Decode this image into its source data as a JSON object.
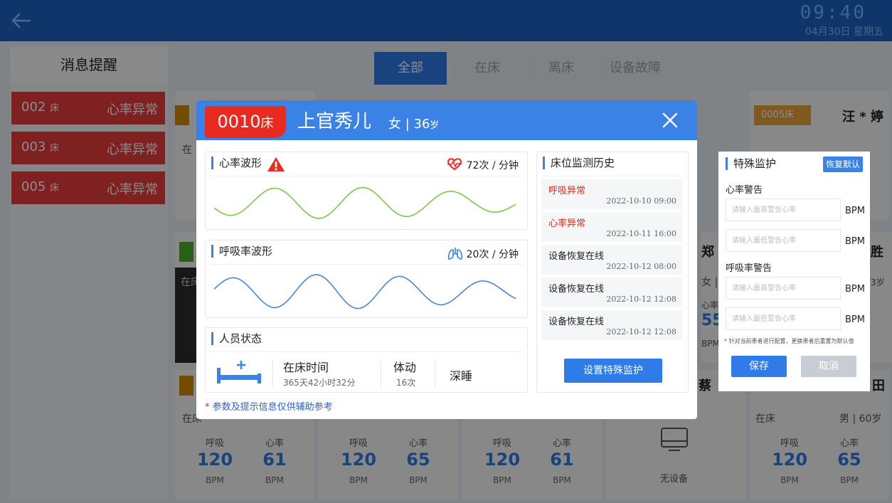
{
  "header": {
    "time": "09:40",
    "date": "04月30日  星期五"
  },
  "sidebar": {
    "title": "消息提醒",
    "alerts": [
      {
        "bed": "002",
        "unit": "床",
        "message": "心率异常"
      },
      {
        "bed": "003",
        "unit": "床",
        "message": "心率异常"
      },
      {
        "bed": "005",
        "unit": "床",
        "message": "心率异常"
      }
    ]
  },
  "filters": [
    "全部",
    "在床",
    "离床",
    "设备故障"
  ],
  "background_cards": {
    "card_5": {
      "bed": "0005床",
      "name": "汪 * 婷"
    },
    "partial_names": [
      "郑",
      "胜",
      "蔡",
      "田"
    ],
    "card_right": {
      "status": "在床",
      "gender_age": "男 | 60岁"
    },
    "metrics": [
      {
        "resp_label": "呼吸",
        "resp": "120",
        "hr_label": "心率",
        "hr": "61",
        "unit": "BPM"
      },
      {
        "resp_label": "呼吸",
        "resp": "120",
        "hr_label": "心率",
        "hr": "65",
        "unit": "BPM"
      },
      {
        "resp_label": "呼吸",
        "resp": "120",
        "hr_label": "心率",
        "hr": "61",
        "unit": "BPM"
      },
      {
        "resp_label": "呼吸",
        "resp": "120",
        "hr_label": "心率",
        "hr": "65",
        "unit": "BPM"
      }
    ],
    "no_device": "无设备",
    "fragments": {
      "in_bed": "在床",
      "heart": "心率",
      "val": "55",
      "bpm": "BPM",
      "female": "女 |",
      "age": "3岁",
      "left_in": "在床",
      "left_in2": "在"
    }
  },
  "modal": {
    "bed_number": "0010",
    "bed_unit": "床",
    "patient_name": "上官秀儿",
    "gender": "女",
    "age": "36",
    "age_unit": "岁",
    "heart_panel": {
      "title": "心率波形",
      "rate": "72次 / 分钟"
    },
    "resp_panel": {
      "title": "呼吸率波形",
      "rate": "20次 / 分钟"
    },
    "status_panel": {
      "title": "人员状态",
      "bed_time_label": "在床时间",
      "bed_time_value": "365天42小时32分",
      "movement_label": "体动",
      "movement_value": "16次",
      "sleep_state": "深睡"
    },
    "history_panel": {
      "title": "床位监测历史",
      "items": [
        {
          "label": "呼吸异常",
          "time": "2022-10-10  09:00",
          "alert": true
        },
        {
          "label": "心率异常",
          "time": "2022-10-11  16:00",
          "alert": true
        },
        {
          "label": "设备恢复在线",
          "time": "2022-10-12  08:00",
          "alert": false
        },
        {
          "label": "设备恢复在线",
          "time": "2022-10-12  12:08",
          "alert": false
        },
        {
          "label": "设备恢复在线",
          "time": "2022-10-12  12:08",
          "alert": false
        }
      ],
      "button": "设置特殊监护"
    },
    "footnote": "参数及提示信息仅供辅助参考",
    "footnote_star": "*"
  },
  "special_monitor": {
    "title": "特殊监护",
    "restore_button": "恢复默认",
    "hr_label": "心率警告",
    "hr_high_placeholder": "请输入最高警告心率",
    "hr_low_placeholder": "请输入最低警告心率",
    "resp_label": "呼吸率警告",
    "resp_high_placeholder": "请输入最高警告心率",
    "resp_low_placeholder": "请输入最低警告心率",
    "unit": "BPM",
    "note": "针对当前患者进行配置，更换患者后重置为默认值",
    "note_star": "*",
    "save_button": "保存",
    "cancel_button": "取消"
  },
  "colors": {
    "topbar": "#1e61c4",
    "accent": "#3a82e6",
    "alert": "#e83c3c",
    "heart_wave": "#7cc84a",
    "resp_wave": "#4a85d8"
  }
}
